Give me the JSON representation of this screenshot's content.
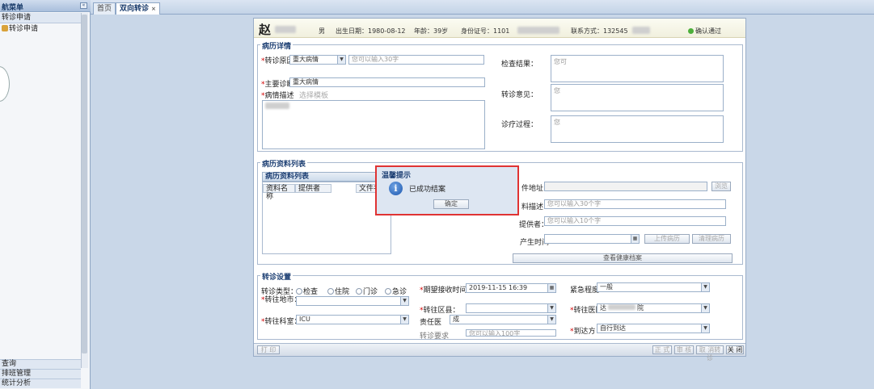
{
  "sidebar": {
    "title": "航菜单",
    "collapse_icon": "«",
    "section": "转诊申请",
    "item": "转诊申请",
    "bottom_items": [
      "查询",
      "排班管理",
      "统计分析"
    ]
  },
  "tabs": [
    {
      "label": "首页"
    },
    {
      "label": "双向转诊",
      "close": "×"
    }
  ],
  "patient": {
    "name": "赵",
    "gender": "男",
    "birth_label": "出生日期：",
    "birth": "1980-08-12",
    "age_label": "年龄：",
    "age": "39岁",
    "id_label": "身份证号：",
    "id": "1101",
    "phone_label": "联系方式：",
    "phone": "132545",
    "status": "确认通过"
  },
  "record": {
    "title": "病历详情",
    "reason_label": "转诊原因：",
    "reason_value": "重大病情",
    "reason_placeholder": "您可以输入30字",
    "diagnosis_label": "主要诊断：",
    "diagnosis_value": "重大病情",
    "history_label": "病情描述",
    "history_hint": "选择模板",
    "exam_label": "检查结果：",
    "exam_value": "您可",
    "opinion_label": "转诊意见：",
    "opinion_value": "您",
    "process_label": "诊疗过程：",
    "process_value": "您"
  },
  "materials": {
    "title": "病历资料列表",
    "grid_title": "病历资料列表",
    "columns": [
      "资料名称",
      "提供者",
      "文件名"
    ],
    "addr_label": "件地址：",
    "browse": "浏览",
    "desc_label": "料描述：",
    "desc_placeholder": "您可以输入30个字",
    "provider_label": "提供者：",
    "provider_placeholder": "您可以输入10个字",
    "time_label": "产生时间",
    "upload_btn": "上传病历",
    "clear_btn": "清理病历",
    "health_btn": "查看健康档案"
  },
  "transfer": {
    "title": "转诊设置",
    "type_label": "转诊类型：",
    "type_options": [
      "检查",
      "住院",
      "门诊",
      "急诊"
    ],
    "city_label": "转往地市：",
    "dept_label": "转往科室：",
    "dept_value": "ICU",
    "time_label": "期望接收时间：",
    "time_value": "2019-11-15  16:39",
    "district_label": "转往区县：",
    "doctor_label": "责任医",
    "doctor_value": "成",
    "extra_label": "转诊要求",
    "extra_placeholder": "您可以输入100字",
    "urgency_label": "紧急程度：",
    "urgency_value": "一般",
    "hospital_label": "转往医院：",
    "hospital_value": "达",
    "hospital_suffix": "院",
    "arrival_label": "到达方",
    "arrival_value": "自行到达"
  },
  "footer": {
    "print": "打 印",
    "buttons": [
      "正 式",
      "审 核",
      "取 消转诊",
      "关 闭"
    ]
  },
  "dialog": {
    "title": "温馨提示",
    "icon": "i",
    "message": "已成功结案",
    "ok": "确定"
  },
  "colors": {
    "accent": "#1d3f73",
    "dialog_border": "#e03333",
    "status_green": "#4caf3a",
    "required": "#d20000"
  }
}
